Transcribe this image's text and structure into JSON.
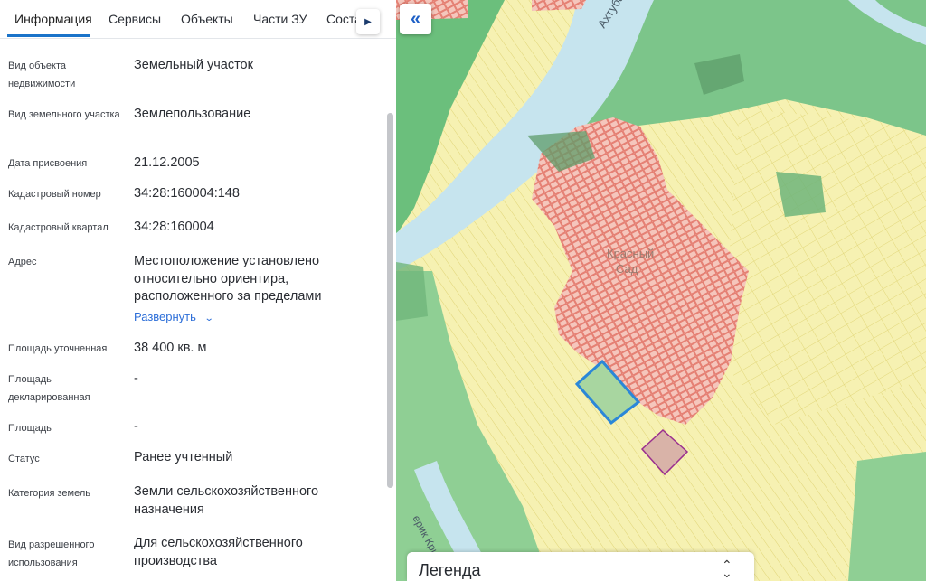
{
  "tabs": [
    {
      "label": "Информация"
    },
    {
      "label": "Сервисы"
    },
    {
      "label": "Объекты"
    },
    {
      "label": "Части ЗУ"
    },
    {
      "label": "Соста"
    }
  ],
  "fields": [
    {
      "label": "Вид объекта недвижимости",
      "value": "Земельный участок"
    },
    {
      "label": "Вид земельного участка",
      "value": "Землепользование"
    },
    {
      "label": "Дата присвоения",
      "value": "21.12.2005"
    },
    {
      "label": "Кадастровый номер",
      "value": "34:28:160004:148"
    },
    {
      "label": "Кадастровый квартал",
      "value": "34:28:160004"
    },
    {
      "label": "Адрес",
      "value": "Местоположение установлено относительно ориентира, расположенного за пределами"
    },
    {
      "label": "Площадь уточненная",
      "value": "38 400 кв. м"
    },
    {
      "label": "Площадь декларированная",
      "value": "-"
    },
    {
      "label": "Площадь",
      "value": "-"
    },
    {
      "label": "Статус",
      "value": "Ранее учтенный"
    },
    {
      "label": "Категория земель",
      "value": "Земли сельскохозяйственного назначения"
    },
    {
      "label": "Вид разрешенного использования",
      "value": "Для сельскохозяйственного производства"
    }
  ],
  "expand_link": "Развернуть",
  "map": {
    "labels": {
      "river": "Ахтуба",
      "creek": "ерик Криво",
      "settlement_1": "Красный",
      "settlement_2": "Сад"
    },
    "legend_title": "Легенда",
    "colors": {
      "river": "#c6e4ee",
      "forest": "#6bbf7c",
      "agricultural": "#f6f1b2",
      "residential": "#f7c8c0",
      "selected_parcel_border": "#2b87d8",
      "secondary_parcel_border": "#9a2f8f"
    }
  }
}
